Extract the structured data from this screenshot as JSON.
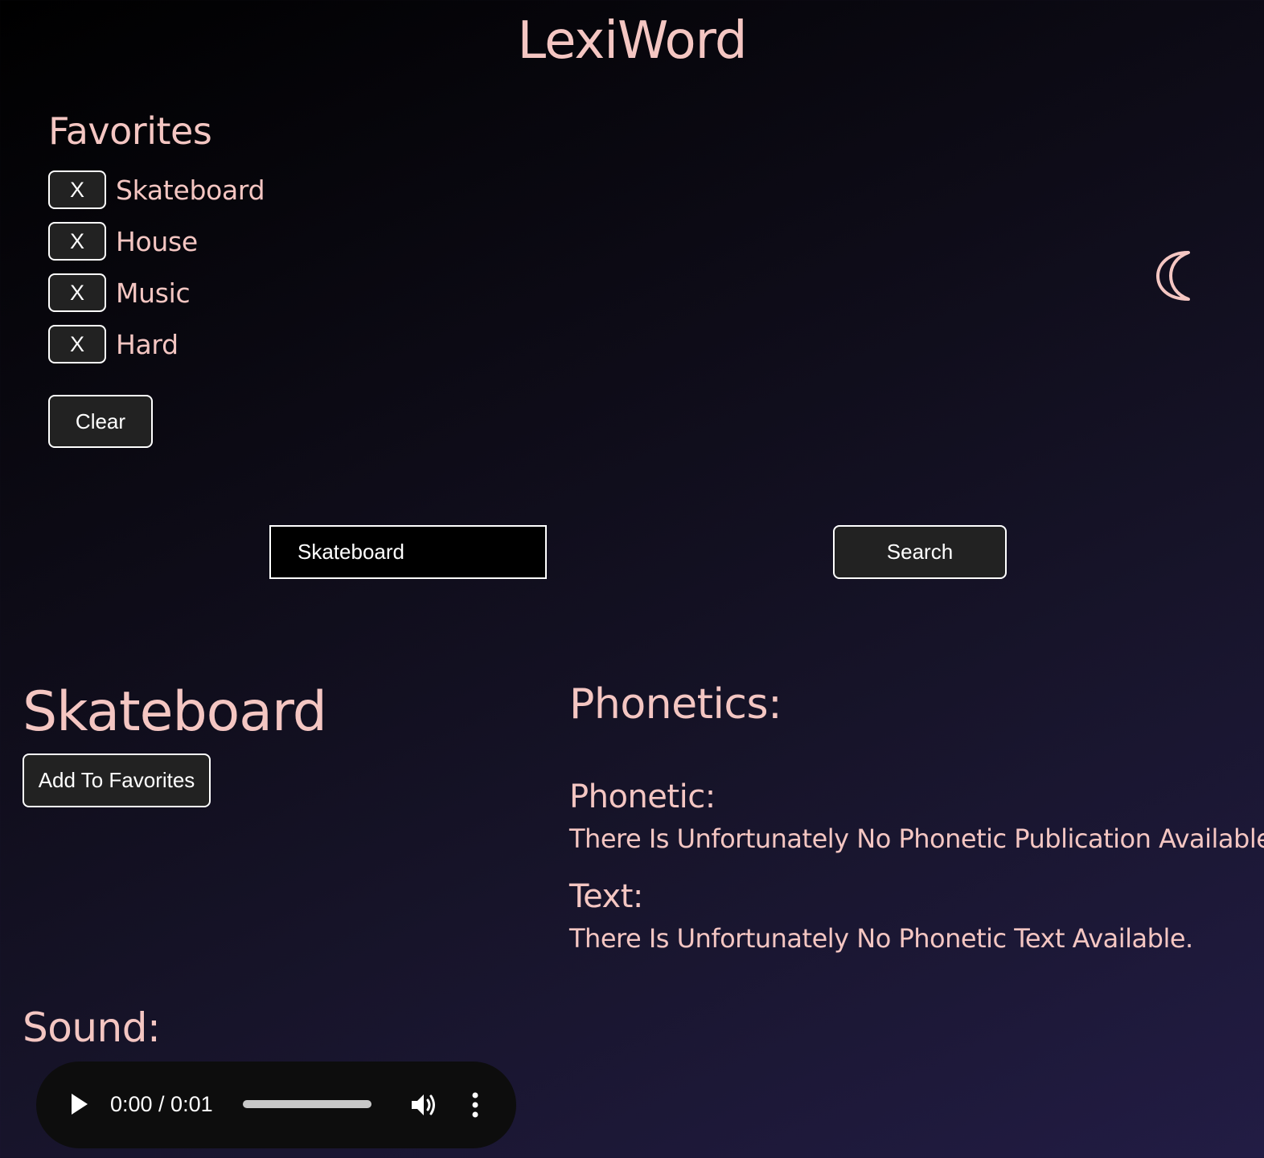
{
  "app": {
    "title": "LexiWord"
  },
  "favorites": {
    "heading": "Favorites",
    "remove_label": "X",
    "items": [
      {
        "label": "Skateboard"
      },
      {
        "label": "House"
      },
      {
        "label": "Music"
      },
      {
        "label": "Hard"
      }
    ],
    "clear_label": "Clear"
  },
  "theme_toggle": {
    "icon": "moon-icon"
  },
  "search": {
    "value": "Skateboard",
    "button_label": "Search"
  },
  "result": {
    "word": "Skateboard",
    "add_favorite_label": "Add To Favorites",
    "phonetics_heading": "Phonetics:",
    "phonetic_label": "Phonetic:",
    "phonetic_value": "There Is Unfortunately No Phonetic Publication Available.",
    "text_label": "Text:",
    "text_value": "There Is Unfortunately No Phonetic Text Available.",
    "sound_heading": "Sound:"
  },
  "audio_player": {
    "time": "0:00 / 0:01",
    "progress": 0
  },
  "colors": {
    "accent": "#f4c6c2",
    "button_bg": "#222222",
    "bg_dark": "#000000",
    "bg_light": "#221c44"
  }
}
